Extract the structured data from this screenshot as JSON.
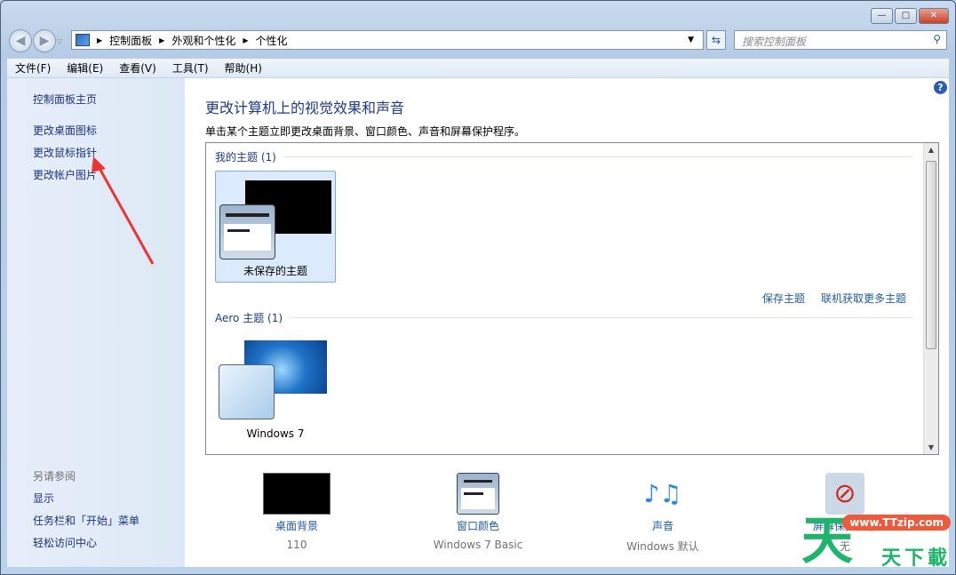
{
  "breadcrumb": [
    "控制面板",
    "外观和个性化",
    "个性化"
  ],
  "search_placeholder": "搜索控制面板",
  "menu": [
    "文件(F)",
    "编辑(E)",
    "查看(V)",
    "工具(T)",
    "帮助(H)"
  ],
  "sidebar": {
    "items": [
      "控制面板主页",
      "更改桌面图标",
      "更改鼠标指针",
      "更改帐户图片"
    ],
    "see_also_label": "另请参阅",
    "see_also": [
      "显示",
      "任务栏和「开始」菜单",
      "轻松访问中心"
    ]
  },
  "main": {
    "title": "更改计算机上的视觉效果和声音",
    "description": "单击某个主题立即更改桌面背景、窗口颜色、声音和屏幕保护程序。",
    "my_themes_label": "我的主题 (1)",
    "unsaved_theme": "未保存的主题",
    "save_theme": "保存主题",
    "get_more": "联机获取更多主题",
    "aero_label": "Aero 主题 (1)",
    "win7_theme": "Windows 7"
  },
  "bottom": [
    {
      "title": "桌面背景",
      "sub": "110"
    },
    {
      "title": "窗口颜色",
      "sub": "Windows 7 Basic"
    },
    {
      "title": "声音",
      "sub": "Windows 默认"
    },
    {
      "title": "屏幕保护程序",
      "sub": "无"
    }
  ],
  "watermark": {
    "url": "www.TTzip.com",
    "text": "天天下載"
  }
}
